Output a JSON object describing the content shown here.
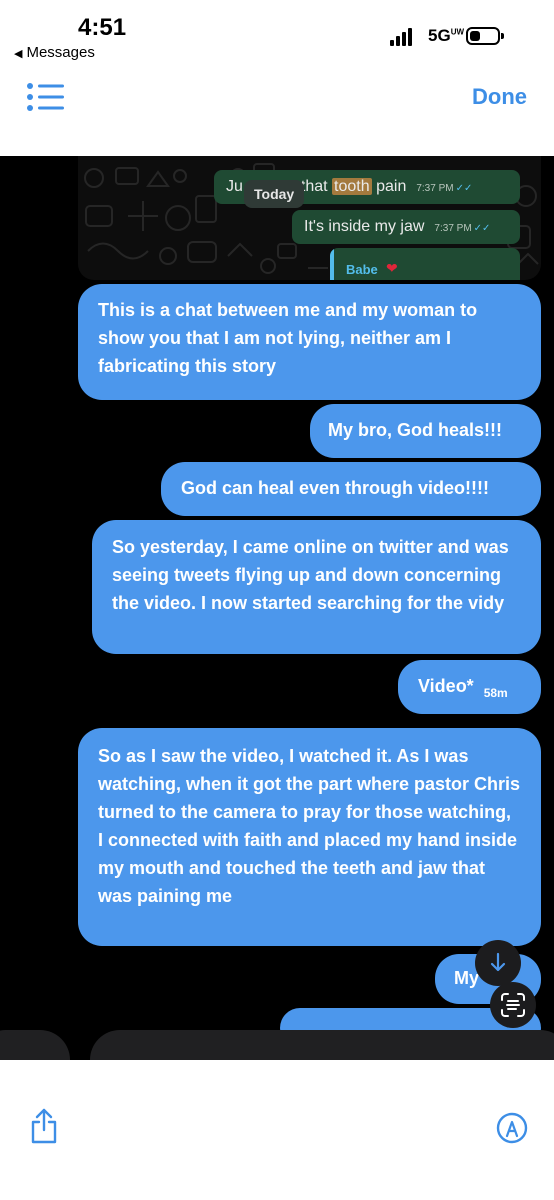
{
  "status_bar": {
    "time": "4:51",
    "back_label": "Messages",
    "network": "5G",
    "network_superscript": "UW"
  },
  "toolbar": {
    "done_label": "Done"
  },
  "screenshot": {
    "whatsapp": {
      "bubble1": {
        "pre": "Ju",
        "post": "that",
        "highlight": "tooth",
        "tail": "pain",
        "time": "7:37 PM"
      },
      "bubble2": {
        "text": "It's inside my jaw",
        "time": "7:37 PM"
      },
      "date_chip": "Today",
      "reply_name": "Babe",
      "reply_icon": "heart-emoji"
    },
    "messages": [
      {
        "text": "This is a chat between me and my woman to show you that I am not lying, neither am I fabricating this story"
      },
      {
        "text": "My bro, God heals!!!"
      },
      {
        "text": "God can heal even through video!!!!"
      },
      {
        "text": "So yesterday, I came online on twitter and was seeing tweets flying up and down concerning the video. I now started searching for the vidy"
      },
      {
        "text": "Video*",
        "time": "58m"
      },
      {
        "text": "So as I saw the video, I watched it. As I was watching, when it got the part where pastor Chris turned to the camera to pray for those watching, I connected with faith and placed my hand inside my mouth and touched the teeth and jaw that was paining me"
      },
      {
        "text": "My"
      }
    ]
  },
  "icons": {
    "list": "list-icon",
    "share": "share-icon",
    "markup": "markup-pen-icon",
    "scroll_down": "arrow-down-icon",
    "live_text": "live-text-icon"
  },
  "colors": {
    "accent": "#3d8ee6",
    "bubble": "#4c97ec",
    "wa_bubble": "#1f4a33"
  }
}
